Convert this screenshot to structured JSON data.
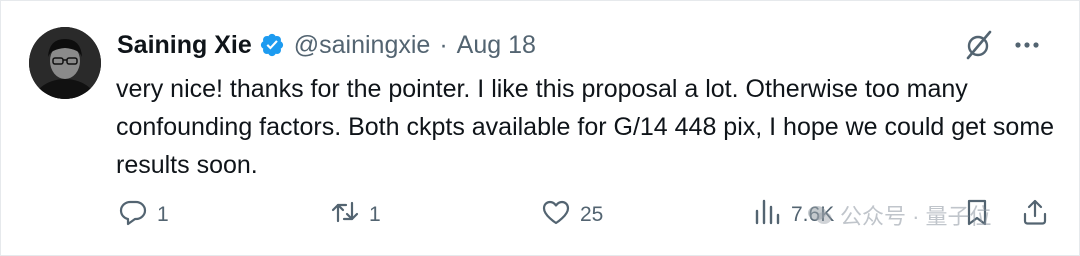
{
  "author": {
    "name": "Saining Xie",
    "handle": "@sainingxie",
    "separator": "·",
    "date": "Aug 18"
  },
  "tweet": {
    "text": "very nice! thanks for the pointer. I like this proposal a lot. Otherwise too many confounding factors. Both ckpts available for G/14 448 pix, I hope we could get some results soon."
  },
  "actions": {
    "replies": "1",
    "retweets": "1",
    "likes": "25",
    "views": "7.6K"
  },
  "watermark": {
    "text": "公众号 · 量子位"
  },
  "icons": {
    "verified": "verified-badge-icon",
    "grok": "grok-slash-icon",
    "more": "more-dots-icon",
    "reply": "reply-bubble-icon",
    "retweet": "retweet-icon",
    "like": "heart-icon",
    "views": "bar-chart-icon",
    "bookmark": "bookmark-icon",
    "share": "share-icon"
  },
  "colors": {
    "text": "#0f1419",
    "muted": "#536471",
    "verified": "#1d9bf0",
    "border": "#e6e9ec"
  }
}
